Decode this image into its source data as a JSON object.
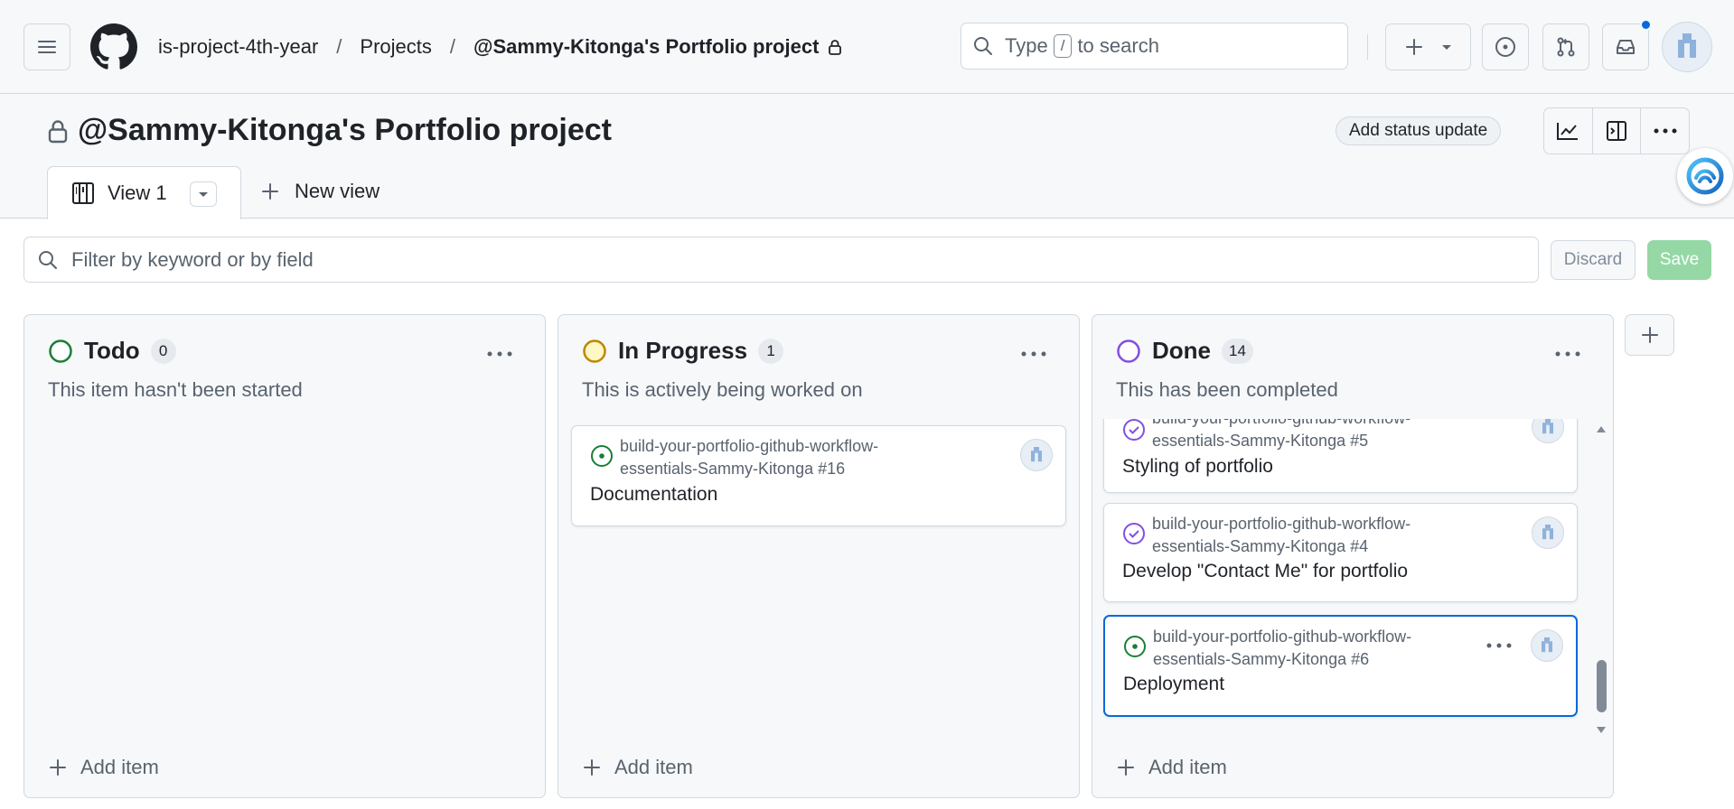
{
  "header": {
    "breadcrumbs": [
      {
        "label": "is-project-4th-year"
      },
      {
        "label": "Projects"
      },
      {
        "label": "@Sammy-Kitonga's Portfolio project"
      }
    ],
    "search": {
      "prefix": "Type",
      "key": "/",
      "suffix": "to search"
    }
  },
  "project": {
    "title": "@Sammy-Kitonga's Portfolio project",
    "status_button": "Add status update",
    "tabs": [
      {
        "label": "View 1"
      }
    ],
    "new_view_label": "New view"
  },
  "filter": {
    "placeholder": "Filter by keyword or by field",
    "discard_label": "Discard",
    "save_label": "Save"
  },
  "board": {
    "add_item_label": "Add item",
    "columns": [
      {
        "name": "Todo",
        "count": "0",
        "description": "This item hasn't been started",
        "color": "#1a7f37",
        "cards": []
      },
      {
        "name": "In Progress",
        "count": "1",
        "description": "This is actively being worked on",
        "color": "#bf8700",
        "cards": [
          {
            "repo_line1": "build-your-portfolio-github-workflow-",
            "repo_line2": "essentials-Sammy-Kitonga #16",
            "title": "Documentation",
            "state": "open"
          }
        ]
      },
      {
        "name": "Done",
        "count": "14",
        "description": "This has been completed",
        "color": "#8250df",
        "cards": [
          {
            "repo_line1": "build-your-portfolio-github-workflow-",
            "repo_line2": "essentials-Sammy-Kitonga #5",
            "title": "Styling of portfolio",
            "state": "closed"
          },
          {
            "repo_line1": "build-your-portfolio-github-workflow-",
            "repo_line2": "essentials-Sammy-Kitonga #4",
            "title": "Develop \"Contact Me\" for portfolio",
            "state": "closed"
          },
          {
            "repo_line1": "build-your-portfolio-github-workflow-",
            "repo_line2": "essentials-Sammy-Kitonga #6",
            "title": "Deployment",
            "state": "open"
          }
        ]
      }
    ]
  },
  "colors": {
    "accent": "#0969da",
    "open": "#1a7f37",
    "closed": "#8250df",
    "save": "#95d8a6"
  },
  "icons": [
    "menu-icon",
    "github-logo-icon",
    "lock-icon",
    "search-icon",
    "plus-icon",
    "chevron-down-icon",
    "issue-opened-icon",
    "pull-request-icon",
    "inbox-icon",
    "avatar",
    "insights-icon",
    "side-panel-icon",
    "kebab-icon",
    "board-icon",
    "copilot-icon",
    "issue-closed-icon"
  ]
}
